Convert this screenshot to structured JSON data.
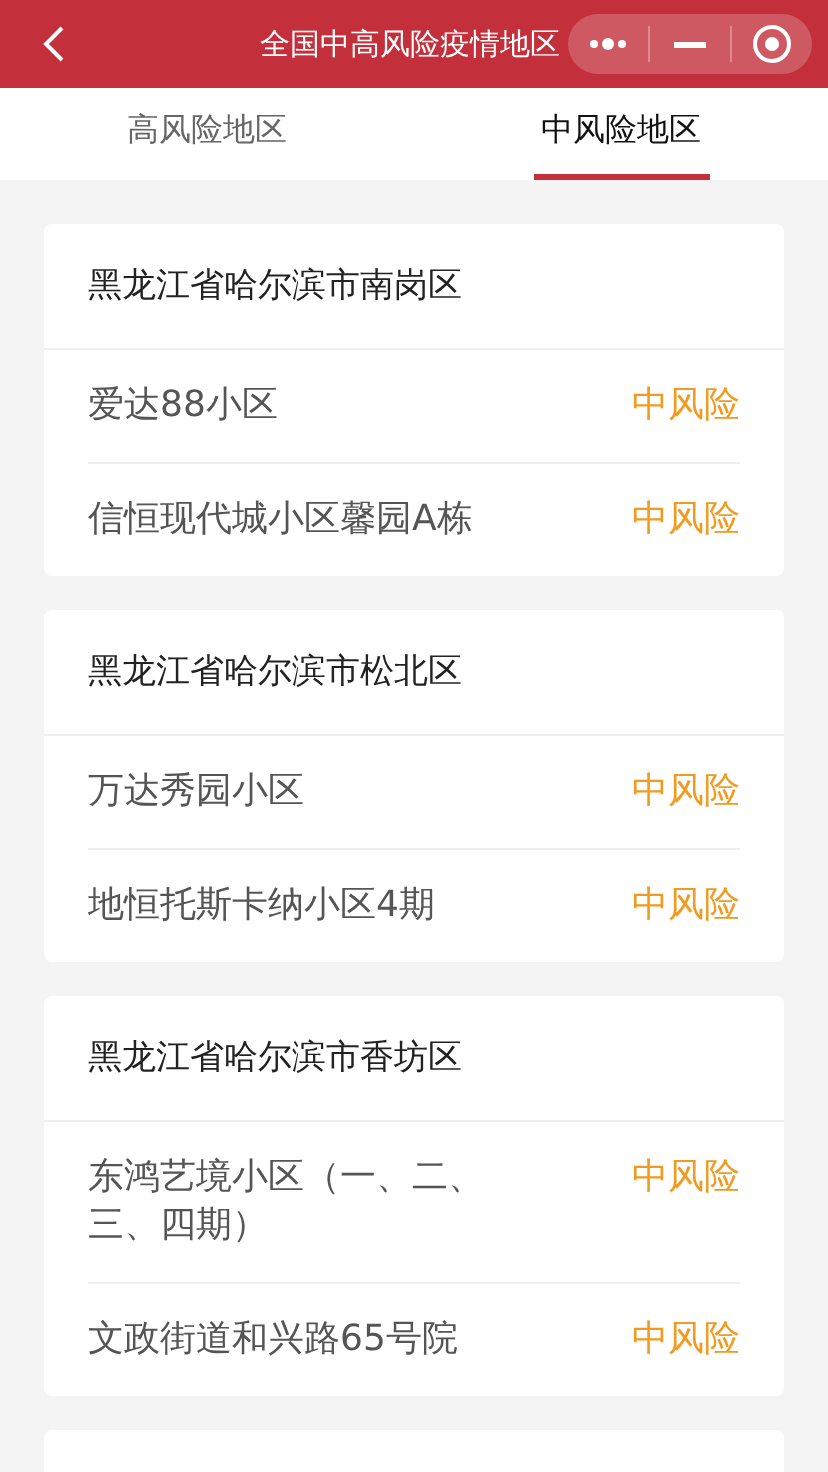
{
  "header": {
    "title": "全国中高风险疫情地区"
  },
  "tabs": [
    {
      "label": "高风险地区",
      "selected": false
    },
    {
      "label": "中风险地区",
      "selected": true
    }
  ],
  "groups": [
    {
      "region": "黑龙江省哈尔滨市南岗区",
      "items": [
        {
          "name": "爱达88小区",
          "risk": "中风险"
        },
        {
          "name": "信恒现代城小区馨园A栋",
          "risk": "中风险"
        }
      ]
    },
    {
      "region": "黑龙江省哈尔滨市松北区",
      "items": [
        {
          "name": "万达秀园小区",
          "risk": "中风险"
        },
        {
          "name": "地恒托斯卡纳小区4期",
          "risk": "中风险"
        }
      ]
    },
    {
      "region": "黑龙江省哈尔滨市香坊区",
      "items": [
        {
          "name": "东鸿艺境小区（一、二、三、四期）",
          "risk": "中风险"
        },
        {
          "name": "文政街道和兴路65号院",
          "risk": "中风险"
        }
      ]
    }
  ]
}
